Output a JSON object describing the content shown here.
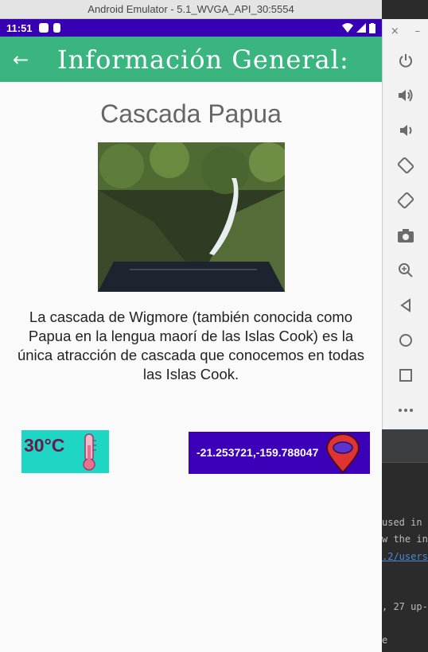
{
  "window": {
    "title": "Android Emulator - 5.1_WVGA_API_30:5554"
  },
  "status_bar": {
    "time": "11:51"
  },
  "app_bar": {
    "title": "Información General:"
  },
  "place": {
    "name": "Cascada Papua",
    "description": "La cascada de Wigmore (también conocida como Papua en la lengua maorí de las Islas Cook) es la única atracción de cascada que conocemos en todas las Islas Cook."
  },
  "weather": {
    "temperature": "30°C"
  },
  "location": {
    "coordinates": "-21.253721,-159.788047"
  },
  "emulator_toolbar": {
    "items": [
      "power-icon",
      "volume-up-icon",
      "volume-down-icon",
      "rotate-left-icon",
      "rotate-right-icon",
      "camera-icon",
      "zoom-icon",
      "back-icon",
      "home-icon",
      "overview-icon",
      "more-icon"
    ]
  },
  "ide": {
    "lines": [
      " used in",
      "w the in",
      ".2/users",
      ", 27 up-",
      "e"
    ]
  },
  "colors": {
    "accent": "#3ab57f",
    "status_bar": "#3700b3",
    "temp_box": "#1fd6c4",
    "coord_box": "#3b00b8"
  }
}
